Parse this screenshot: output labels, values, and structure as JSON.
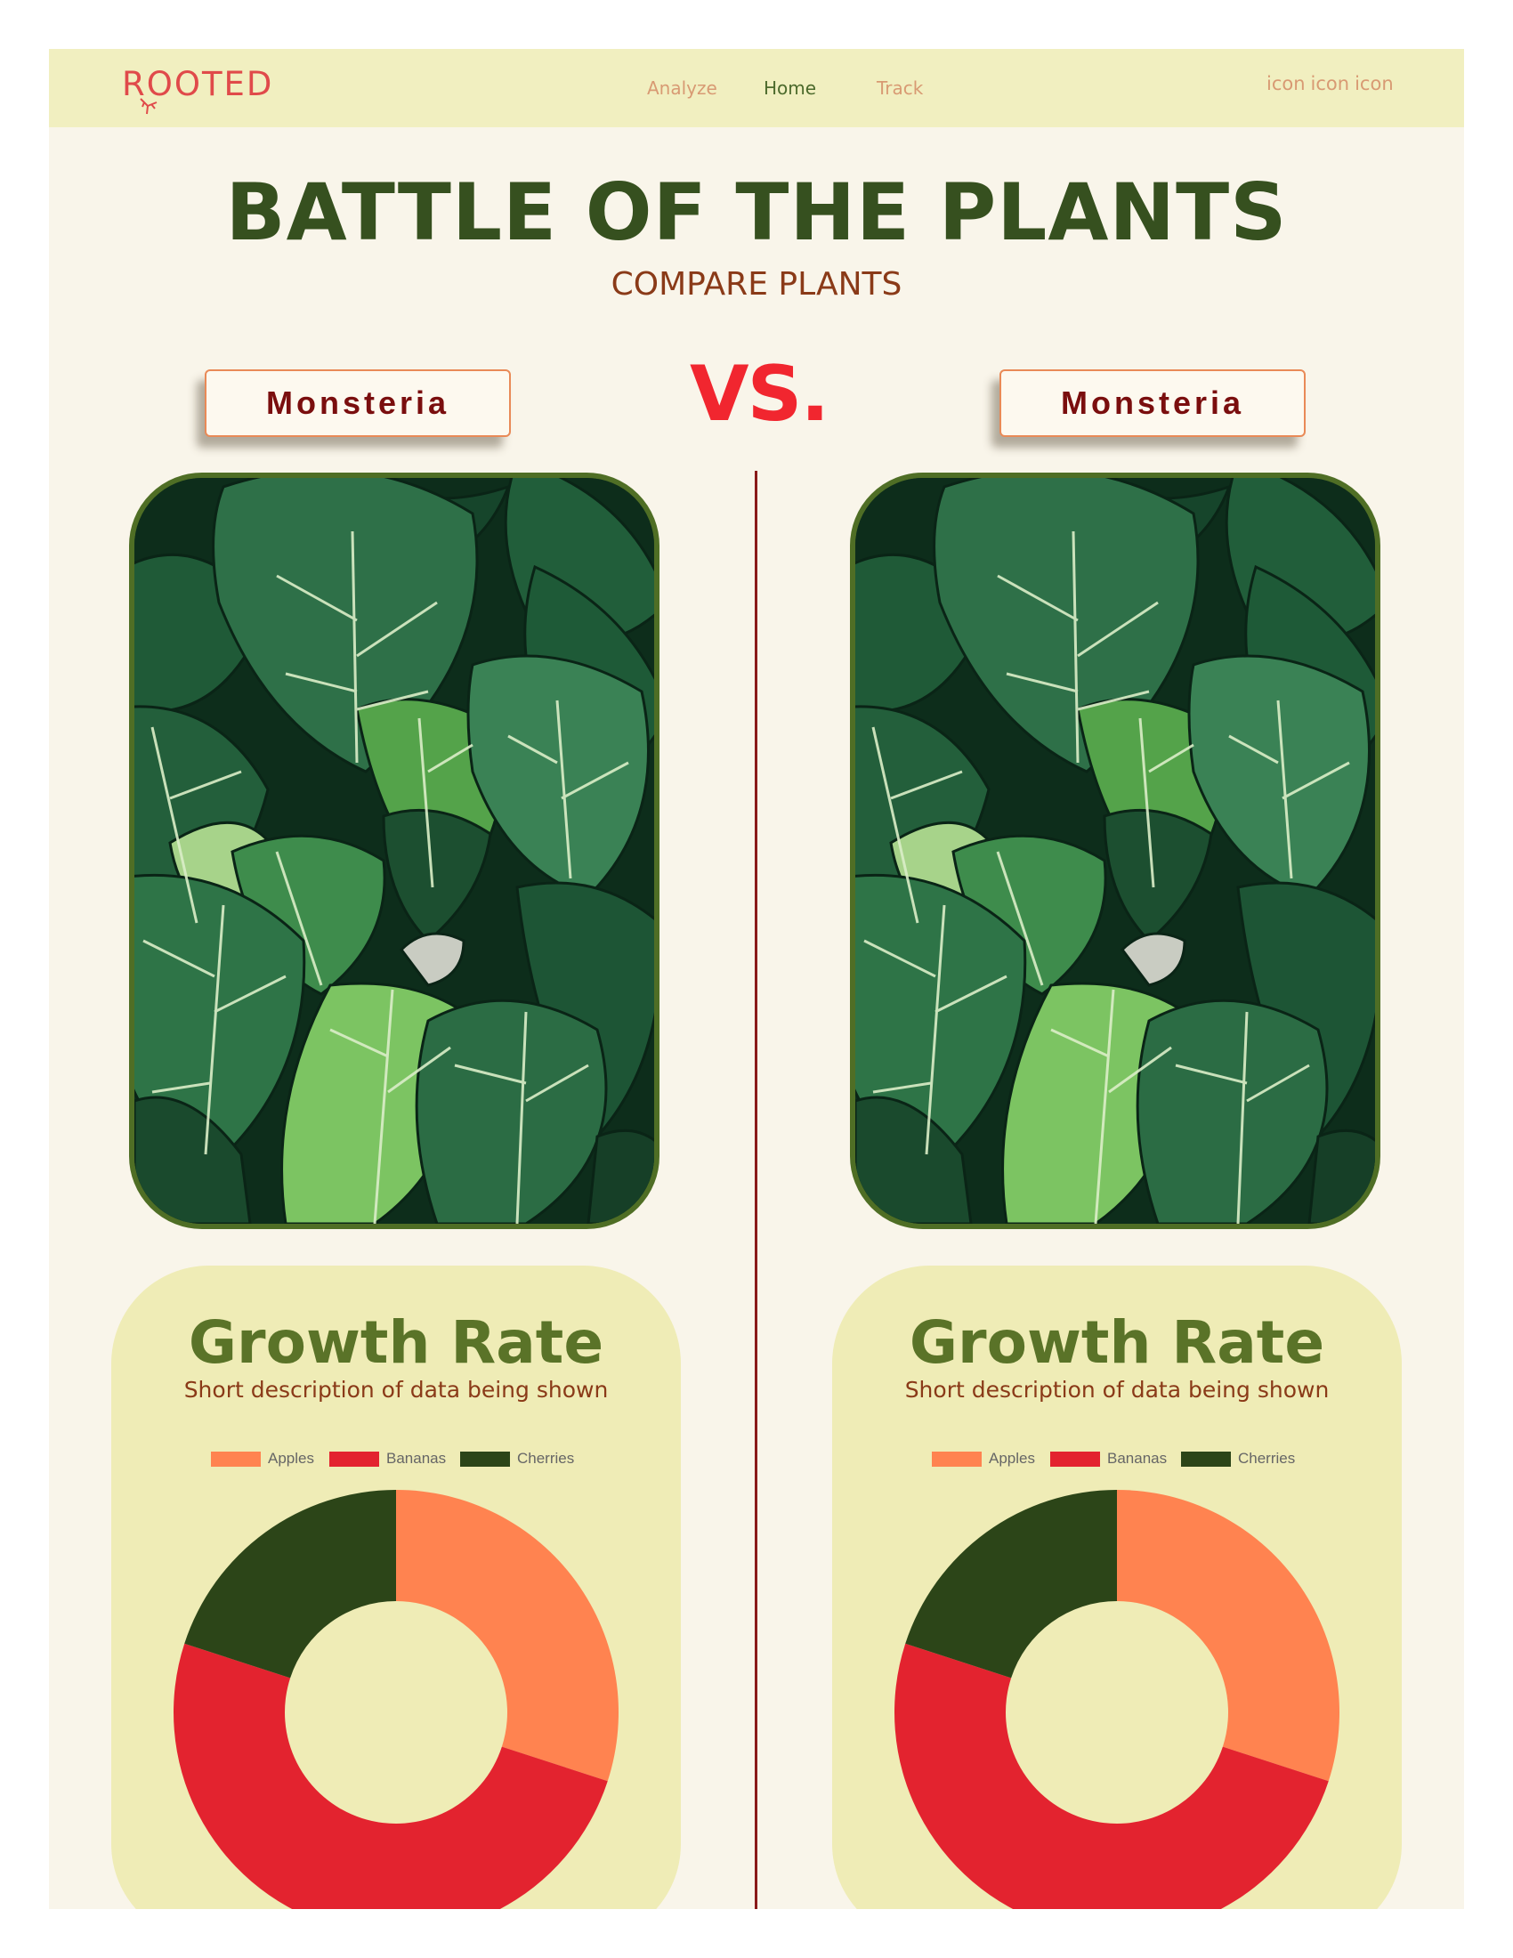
{
  "nav": {
    "logo": "ROOTED",
    "links": [
      "Analyze",
      "Home",
      "Track"
    ],
    "active": "Home",
    "icons": [
      "icon",
      "icon",
      "icon"
    ]
  },
  "hero": {
    "title": "BATTLE OF THE PLANTS",
    "subtitle": "COMPARE PLANTS"
  },
  "vs_label": "VS.",
  "plants": [
    {
      "name": "Monsteria",
      "photo_icon": "monstera-leaves-photo",
      "card": {
        "title": "Growth Rate",
        "description": "Short description of data being shown"
      }
    },
    {
      "name": "Monsteria",
      "photo_icon": "monstera-leaves-photo",
      "card": {
        "title": "Growth Rate",
        "description": "Short description of data being shown"
      }
    }
  ],
  "colors": {
    "nav_bg": "#f1efc0",
    "page_bg": "#f9f5ea",
    "title_green": "#36501f",
    "accent_red": "#f1262f",
    "divider": "#8a1a1a"
  },
  "chart_data": [
    {
      "type": "pie",
      "donut": true,
      "categories": [
        "Apples",
        "Bananas",
        "Cherries"
      ],
      "values": [
        30,
        50,
        20
      ],
      "colors": [
        "#ff8350",
        "#e3232f",
        "#2c4518"
      ],
      "legend": "top"
    },
    {
      "type": "pie",
      "donut": true,
      "categories": [
        "Apples",
        "Bananas",
        "Cherries"
      ],
      "values": [
        30,
        50,
        20
      ],
      "colors": [
        "#ff8350",
        "#e3232f",
        "#2c4518"
      ],
      "legend": "top"
    }
  ]
}
